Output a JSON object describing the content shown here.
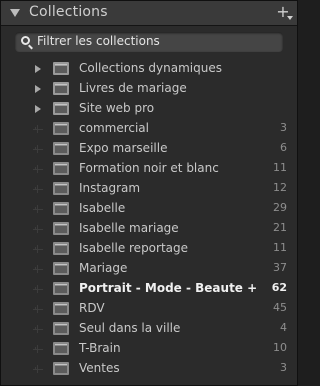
{
  "panel": {
    "title": "Collections",
    "add_icon": "plus-icon"
  },
  "search": {
    "placeholder": "Filtrer les collections",
    "icon": "search-icon"
  },
  "sets": [
    {
      "label": "Collections dynamiques"
    },
    {
      "label": "Livres de mariage"
    },
    {
      "label": "Site web pro"
    }
  ],
  "collections": [
    {
      "label": "commercial",
      "count": "3"
    },
    {
      "label": "Expo marseille",
      "count": "6"
    },
    {
      "label": "Formation noir et blanc",
      "count": "11"
    },
    {
      "label": "Instagram",
      "count": "12"
    },
    {
      "label": "Isabelle",
      "count": "29"
    },
    {
      "label": "Isabelle mariage",
      "count": "21"
    },
    {
      "label": "Isabelle reportage",
      "count": "11"
    },
    {
      "label": "Mariage",
      "count": "37"
    },
    {
      "label": "Portrait - Mode - Beaute +",
      "count": "62",
      "selected": true
    },
    {
      "label": "RDV",
      "count": "45"
    },
    {
      "label": "Seul dans la ville",
      "count": "4"
    },
    {
      "label": "T-Brain",
      "count": "10"
    },
    {
      "label": "Ventes",
      "count": "3"
    }
  ]
}
